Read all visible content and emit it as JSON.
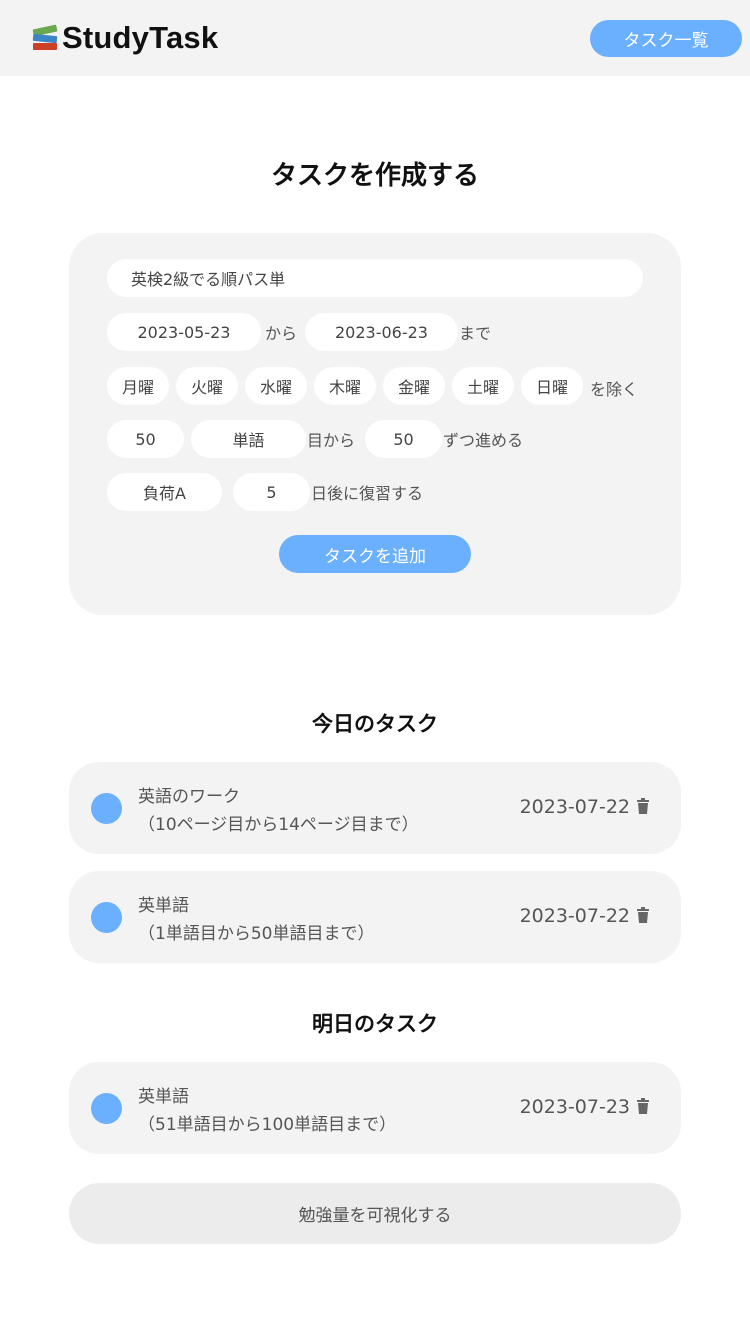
{
  "header": {
    "brand": "StudyTask",
    "logo_icon": "books-icon",
    "nav_button_label": "タスク一覧",
    "accent_color": "#6ab0ff",
    "background_color": "#f3f3f3"
  },
  "create_form": {
    "title": "タスクを作成する",
    "task_name": "英検2級でる順パス単",
    "start_date": "2023-05-23",
    "from_label": "から",
    "end_date": "2023-06-23",
    "until_label": "まで",
    "weekdays": [
      "月曜",
      "火曜",
      "水曜",
      "木曜",
      "金曜",
      "土曜",
      "日曜"
    ],
    "exclude_label": "を除く",
    "start_number": "50",
    "unit": "単語",
    "from_item_label": "目から",
    "step": "50",
    "step_label": "ずつ進める",
    "load": "負荷A",
    "review_days": "5",
    "review_label": "日後に復習する",
    "add_button_label": "タスクを追加"
  },
  "today": {
    "title": "今日のタスク",
    "tasks": [
      {
        "name": "英語のワーク",
        "range": "（10ページ目から14ページ目まで）",
        "date": "2023-07-22"
      },
      {
        "name": "英単語",
        "range": "（1単語目から50単語目まで）",
        "date": "2023-07-22"
      }
    ]
  },
  "tomorrow": {
    "title": "明日のタスク",
    "tasks": [
      {
        "name": "英単語",
        "range": "（51単語目から100単語目まで）",
        "date": "2023-07-23"
      }
    ]
  },
  "visualize_button_label": "勉強量を可視化する"
}
